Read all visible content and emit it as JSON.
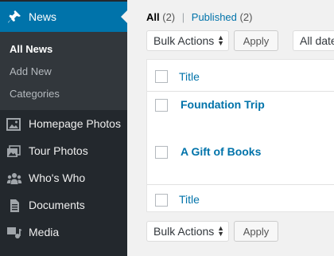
{
  "sidebar": {
    "active_menu": {
      "label": "News",
      "icon": "pushpin-icon"
    },
    "submenu": [
      {
        "label": "All News",
        "current": true
      },
      {
        "label": "Add New",
        "current": false
      },
      {
        "label": "Categories",
        "current": false
      }
    ],
    "items": [
      {
        "label": "Homepage Photos",
        "icon": "image-icon"
      },
      {
        "label": "Tour Photos",
        "icon": "gallery-icon"
      },
      {
        "label": "Who's Who",
        "icon": "groups-icon"
      },
      {
        "label": "Documents",
        "icon": "document-icon"
      },
      {
        "label": "Media",
        "icon": "media-icon"
      }
    ]
  },
  "filters": {
    "all_label": "All",
    "all_count": "(2)",
    "separator": "|",
    "published_label": "Published",
    "published_count": "(2)"
  },
  "top_actions": {
    "bulk_select": "Bulk Actions",
    "apply_label": "Apply",
    "dates_select": "All date"
  },
  "table": {
    "header_title": "Title",
    "footer_title": "Title",
    "rows": [
      {
        "title": "Foundation Trip"
      },
      {
        "title": "A Gift of Books"
      }
    ]
  },
  "bottom_actions": {
    "bulk_select": "Bulk Actions",
    "apply_label": "Apply"
  },
  "colors": {
    "accent": "#0073aa",
    "sidebar_bg": "#23282d",
    "submenu_bg": "#32373c"
  }
}
